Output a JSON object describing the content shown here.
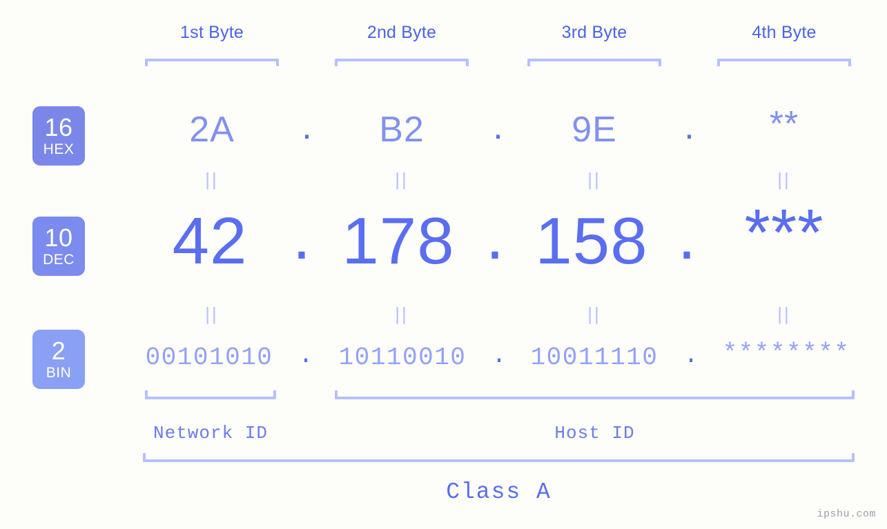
{
  "watermark": "ipshu.com",
  "byte_headers": [
    {
      "label": "1st Byte"
    },
    {
      "label": "2nd Byte"
    },
    {
      "label": "3rd Byte"
    },
    {
      "label": "4th Byte"
    }
  ],
  "bases": [
    {
      "number": "16",
      "name": "HEX",
      "color": "#7b87e8"
    },
    {
      "number": "10",
      "name": "DEC",
      "color": "#7b8bee"
    },
    {
      "number": "2",
      "name": "BIN",
      "color": "#8aa0f5"
    }
  ],
  "rows": {
    "hex": {
      "base": "16",
      "name": "HEX",
      "values": [
        "2A",
        "B2",
        "9E",
        "**"
      ],
      "separator": "."
    },
    "dec": {
      "base": "10",
      "name": "DEC",
      "values": [
        "42",
        "178",
        "158",
        "***"
      ],
      "separator": "."
    },
    "bin": {
      "base": "2",
      "name": "BIN",
      "values": [
        "00101010",
        "10110010",
        "10011110",
        "********"
      ],
      "separator": "."
    }
  },
  "equals_marks": {
    "symbol": "||",
    "count_per_row": 4
  },
  "id_sections": [
    {
      "label": "Network ID"
    },
    {
      "label": "Host ID"
    }
  ],
  "class": {
    "label": "Class A"
  },
  "colors": {
    "background": "#fdfdfa",
    "heading_text": "#4a63e7",
    "bracket": "#b6c0fb",
    "hex_value": "#8191f0",
    "dec_value": "#5a6ef0",
    "bin_value": "#93a1f4",
    "dot": "#5a6ef0",
    "equals": "#b6c0fb",
    "badge_hex": "#7b87e8",
    "badge_dec": "#7b8bee",
    "badge_bin": "#8aa0f5",
    "id_label": "#6b7bee",
    "class_label": "#5a6ef0",
    "watermark": "#9aa0a8"
  }
}
